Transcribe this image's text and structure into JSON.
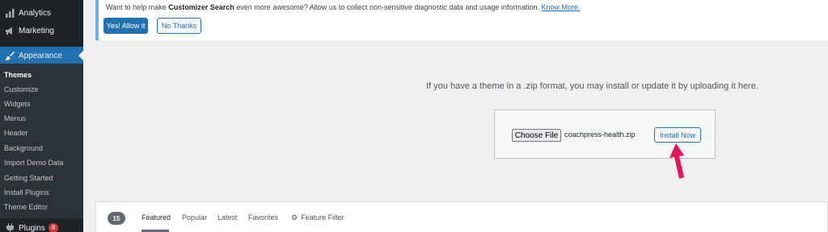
{
  "sidebar": {
    "menu": [
      {
        "label": "Analytics",
        "icon": "analytics-icon"
      },
      {
        "label": "Marketing",
        "icon": "megaphone-icon"
      },
      {
        "label": "Appearance",
        "icon": "paintbrush-icon"
      },
      {
        "label": "Plugins",
        "icon": "plugin-icon",
        "badge": "8"
      }
    ],
    "submenu": [
      "Themes",
      "Customize",
      "Widgets",
      "Menus",
      "Header",
      "Background",
      "Import Demo Data",
      "Getting Started",
      "Install Plugins",
      "Theme Editor"
    ]
  },
  "notice": {
    "text_before": "Want to help make ",
    "text_bold": "Customizer Search",
    "text_after": " even more awesome? Allow us to collect non-sensitive diagnostic data and usage information. ",
    "link": "Know More.",
    "allow_label": "Yes! Allow it",
    "decline_label": "No Thanks"
  },
  "upload": {
    "message": "If you have a theme in a .zip format, you may install or update it by uploading it here.",
    "choose_label": "Choose File",
    "file_name": "coachpress-health.zip",
    "install_label": "Install Now"
  },
  "filter_bar": {
    "count": "15",
    "tabs": [
      "Featured",
      "Popular",
      "Latest",
      "Favorites"
    ],
    "feature_filter": "Feature Filter"
  },
  "colors": {
    "sidebar": "#1d2327",
    "accent": "#2271b1",
    "arrow": "#e4165a"
  }
}
